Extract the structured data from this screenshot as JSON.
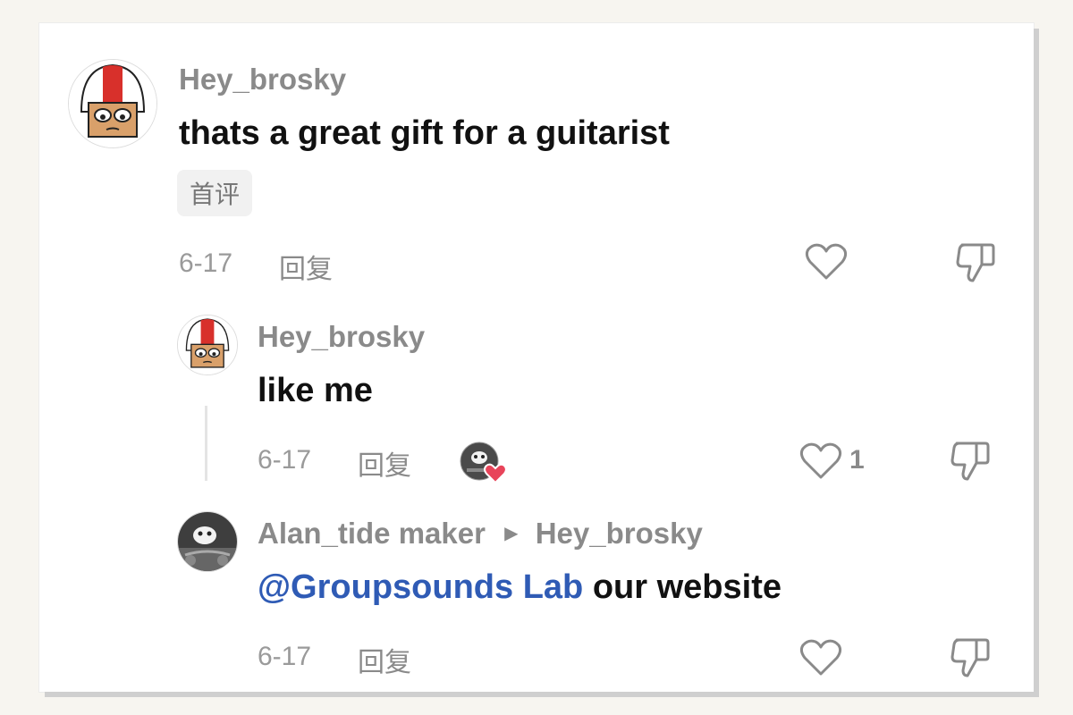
{
  "comments": [
    {
      "username": "Hey_brosky",
      "text": "thats a great gift for a guitarist",
      "tag": "首评",
      "date": "6-17",
      "reply_label": "回复",
      "avatar": "helmet-cartoon-avatar",
      "like_icon": "heart-icon",
      "dislike_icon": "thumbs-down-icon"
    },
    {
      "username": "Hey_brosky",
      "text": "like me",
      "date": "6-17",
      "reply_label": "回复",
      "avatar": "helmet-cartoon-avatar",
      "like_count": "1",
      "liked_by_avatar": "dog-photo-avatar",
      "like_icon": "heart-icon",
      "dislike_icon": "thumbs-down-icon"
    },
    {
      "username": "Alan_tide maker",
      "reply_to": "Hey_brosky",
      "mention": "@Groupsounds Lab",
      "text": "our website",
      "date": "6-17",
      "reply_label": "回复",
      "avatar": "dog-photo-avatar",
      "like_icon": "heart-icon",
      "dislike_icon": "thumbs-down-icon"
    }
  ],
  "colors": {
    "mention": "#2f5bb5",
    "username": "#8a8a8a",
    "text": "#111111",
    "liked_heart": "#e8445a"
  }
}
